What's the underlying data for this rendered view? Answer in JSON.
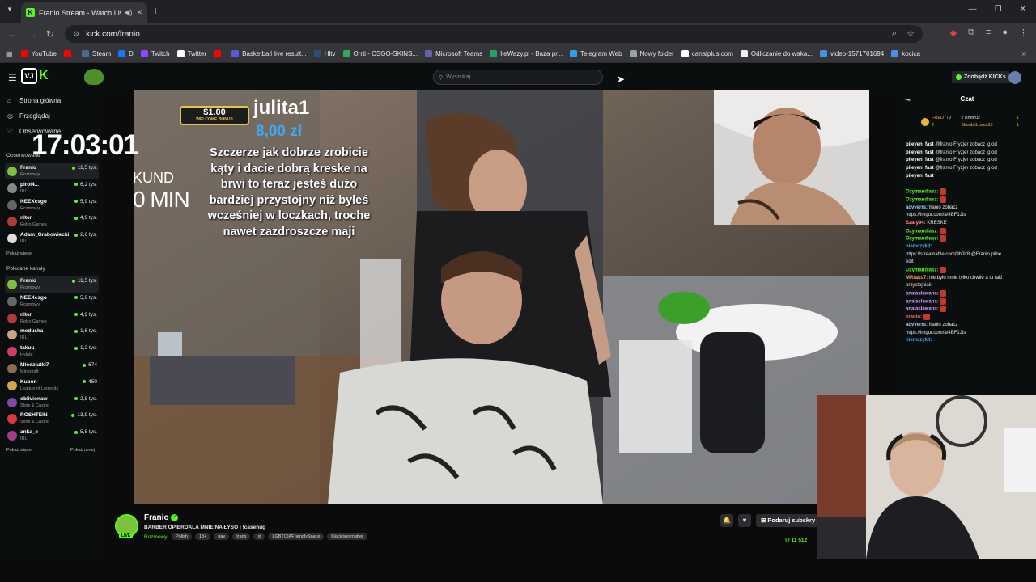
{
  "browser": {
    "tab_title": "Franio Stream - Watch Live",
    "url": "kick.com/franio",
    "bookmarks": [
      {
        "label": "YouTube",
        "color": "#ff0000"
      },
      {
        "label": "",
        "color": "#ff0000"
      },
      {
        "label": "Steam",
        "color": "#4a6b8a"
      },
      {
        "label": "D",
        "color": "#1877f2"
      },
      {
        "label": "Twitch",
        "color": "#9146ff"
      },
      {
        "label": "Twitter",
        "color": "#ffffff"
      },
      {
        "label": "",
        "color": "#ff0000"
      },
      {
        "label": "Basketball live result...",
        "color": "#5a5ad6"
      },
      {
        "label": "Hltv",
        "color": "#2f4d7a"
      },
      {
        "label": "Orrti - CSGO-SKINS...",
        "color": "#34a853"
      },
      {
        "label": "Microsoft Teams",
        "color": "#6264a7"
      },
      {
        "label": "IleWazy.pl - Baza pr...",
        "color": "#1fa463"
      },
      {
        "label": "Telegram Web",
        "color": "#2aa3df"
      },
      {
        "label": "Nowy folder",
        "color": "#9aa0a6"
      },
      {
        "label": "canalplus.com",
        "color": "#ffffff"
      },
      {
        "label": "Odliczanie do waka...",
        "color": "#eeeeee"
      },
      {
        "label": "video-1571701694",
        "color": "#4a90e2"
      },
      {
        "label": "kocica",
        "color": "#4a90e2"
      }
    ]
  },
  "header": {
    "search_placeholder": "Wyszukaj",
    "kicks_button": "Zdobądź KICKs",
    "logo_box": "VJ",
    "logo_k": "K"
  },
  "sidebar": {
    "nav": [
      {
        "label": "Strona główna",
        "icon": "home-icon"
      },
      {
        "label": "Przeglądaj",
        "icon": "compass-icon"
      },
      {
        "label": "Obserwowane",
        "icon": "heart-icon"
      }
    ],
    "followed_title": "Obserwowane",
    "followed": [
      {
        "name": "Franio",
        "category": "Rozmowy",
        "viewers": "11,5 tys.",
        "color": "#7cc13e",
        "active": true
      },
      {
        "name": "piroi4...",
        "category": "IRL",
        "viewers": "6,2 tys.",
        "color": "#888888"
      },
      {
        "name": "NEEXcsgo",
        "category": "Rozmowy",
        "viewers": "5,9 tys.",
        "color": "#666666"
      },
      {
        "name": "niter",
        "category": "Retro Games",
        "viewers": "4,9 tys.",
        "color": "#b33a3a"
      },
      {
        "name": "Adam_Grabowiecki",
        "category": "IRL",
        "viewers": "2,6 tys.",
        "color": "#dddddd"
      }
    ],
    "show_more_1": "Pokaż więcej",
    "recommended_title": "Polecane kanały",
    "recommended": [
      {
        "name": "Franio",
        "category": "Rozmowy",
        "viewers": "11,5 tys.",
        "color": "#7cc13e",
        "active": true
      },
      {
        "name": "NEEXcsgo",
        "category": "Rozmowy",
        "viewers": "5,9 tys.",
        "color": "#666666"
      },
      {
        "name": "niter",
        "category": "Retro Games",
        "viewers": "4,9 tys.",
        "color": "#b33a3a"
      },
      {
        "name": "meduska",
        "category": "IRL",
        "viewers": "1,6 tys.",
        "color": "#c9a38a"
      },
      {
        "name": "takuu",
        "category": "Hytale",
        "viewers": "1,2 tys.",
        "color": "#cf3d6b"
      },
      {
        "name": "Mlodziutki7",
        "category": "Minecraft",
        "viewers": "674",
        "color": "#8a6d4a"
      },
      {
        "name": "Kubon",
        "category": "League of Legends",
        "viewers": "450",
        "color": "#d4a64a"
      },
      {
        "name": "oblivionaw",
        "category": "Slots & Casino",
        "viewers": "2,8 tys.",
        "color": "#7a4aa8"
      },
      {
        "name": "ROSHTEIN",
        "category": "Slots & Casino",
        "viewers": "13,9 tys.",
        "color": "#d63a3a"
      },
      {
        "name": "anka_e",
        "category": "IRL",
        "viewers": "5,8 tys.",
        "color": "#a83a8a"
      }
    ],
    "show_more_2": "Pokaż więcej",
    "show_less": "Pokaż mniej"
  },
  "overlay": {
    "clock": "17:03:01",
    "sekund": "KUND",
    "min": "0 MIN",
    "donation_amount_badge": "$1.00",
    "donation_badge_text": "WELCOME BONUS",
    "donor": "julita1",
    "donate_amount": "8,00 zł",
    "donate_message": "Szczerze jak dobrze zrobicie kąty i dacie dobrą kreske na brwi to teraz jesteś dużo bardziej przystojny niż byłeś wcześniej w loczkach, troche nawet zazdroszcze maji"
  },
  "chat": {
    "title": "Czat",
    "leaders": [
      {
        "name": "FRED779",
        "count": "2"
      },
      {
        "name": "77thetruz",
        "count": "1"
      },
      {
        "name": "GambitLuxus35",
        "count": "1"
      }
    ],
    "lines": [
      {
        "user": "pileyen, fast",
        "ucolor": "#ffffff",
        "msg": "@franio Fryzjer zobacz ig od"
      },
      {
        "user": "pileyen, fast",
        "ucolor": "#ffffff",
        "msg": "@franio Fryzjer zobacz ig od"
      },
      {
        "user": "pileyen, fast",
        "ucolor": "#ffffff",
        "msg": "@franio Fryzjer zobacz ig od"
      },
      {
        "user": "pileyen, fast",
        "ucolor": "#ffffff",
        "msg": "@franio Fryzjer zobacz ig od"
      },
      {
        "user": "pileyen, fast",
        "ucolor": "#ffffff",
        "msg": ""
      },
      {
        "user": "",
        "ucolor": "#ffffff",
        "msg": ""
      },
      {
        "user": "Ozymandiasz:",
        "ucolor": "#53fc18",
        "msg": "",
        "emote": true
      },
      {
        "user": "Ozymandiasz:",
        "ucolor": "#53fc18",
        "msg": "",
        "emote": true
      },
      {
        "user": "advverrs:",
        "ucolor": "#9ad0ff",
        "msg": "franio zobacz"
      },
      {
        "user": "",
        "ucolor": "#ffffff",
        "msg": "https://imgur.com/a/4BF1Jts"
      },
      {
        "user": "Szary94:",
        "ucolor": "#ff8a8a",
        "msg": "KRESKE"
      },
      {
        "user": "Ozymandiasz:",
        "ucolor": "#53fc18",
        "msg": "",
        "emote": true
      },
      {
        "user": "Ozymandiasz:",
        "ucolor": "#53fc18",
        "msg": "",
        "emote": true
      },
      {
        "user": "niemczykjt:",
        "ucolor": "#3fa9f5",
        "msg": ""
      },
      {
        "user": "",
        "ucolor": "#ffffff",
        "msg": "https://streamable.com/9b0lr8 @Franio pilne"
      },
      {
        "user": "",
        "ucolor": "#ffffff",
        "msg": "edit"
      },
      {
        "user": "Ozymandiasz:",
        "ucolor": "#53fc18",
        "msg": "",
        "emote": true
      },
      {
        "user": "MRraku7:",
        "ucolor": "#ff9a4a",
        "msg": "nie było mnie tylko chwile a tu taki"
      },
      {
        "user": "",
        "ucolor": "#ffffff",
        "msg": "przystojniak"
      },
      {
        "user": "analaslawana:",
        "ucolor": "#cfa0ff",
        "msg": "",
        "emote": true
      },
      {
        "user": "analaslawana:",
        "ucolor": "#cfa0ff",
        "msg": "",
        "emote": true
      },
      {
        "user": "analaslawana:",
        "ucolor": "#cfa0ff",
        "msg": "",
        "emote": true
      },
      {
        "user": "sranio:",
        "ucolor": "#ff6a6a",
        "msg": "",
        "emote": true
      },
      {
        "user": "advverrs:",
        "ucolor": "#9ad0ff",
        "msg": "franio zobacz"
      },
      {
        "user": "",
        "ucolor": "#ffffff",
        "msg": "https://imgur.com/a/4BF1Jts"
      },
      {
        "user": "niemczykjt:",
        "ucolor": "#3fa9f5",
        "msg": ""
      }
    ]
  },
  "stream": {
    "name": "Franio",
    "title": "BARBER OPIERDALA MNIE NA ŁYSO | !casehug",
    "category": "Rozmowy",
    "tags": [
      "Polish",
      "18+",
      "gay",
      "trans",
      "xi",
      "LGBTQIAFriendlySpace",
      "blacklivesmatter"
    ],
    "live": "LIVE",
    "subscribe": "Podaruj subskry",
    "viewers": "11 512"
  },
  "colors": {
    "accent": "#53fc18"
  }
}
